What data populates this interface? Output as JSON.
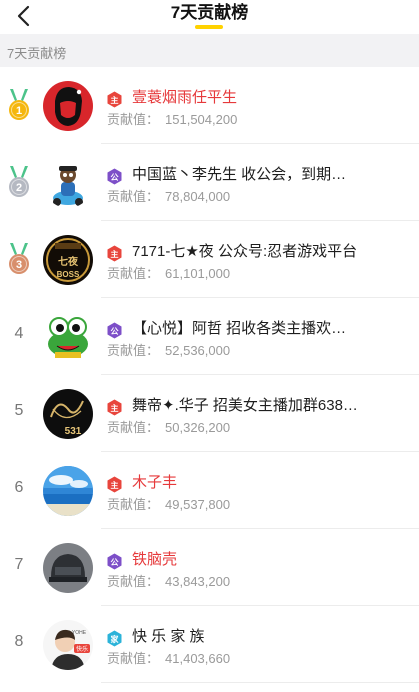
{
  "header": {
    "title": "7天贡献榜",
    "accent_color": "#ffd200"
  },
  "section": {
    "label": "7天贡献榜"
  },
  "contribution_label": "贡献值：",
  "badge_labels": {
    "host": "主",
    "guild": "公",
    "family": "家"
  },
  "colors": {
    "host_badge": "#e8453c",
    "guild_badge": "#7d4fc8",
    "family_badge": "#2bb3d9",
    "name_highlight": "#e6393b",
    "gold_medal": "#f5b70e",
    "silver_medal": "#b5b9c2",
    "bronze_medal": "#d88f6c"
  },
  "entries": [
    {
      "rank": "1",
      "medal": "gold",
      "badge": "host",
      "name": "壹蓑烟雨任平生",
      "name_color": "red",
      "value": "151,504,200",
      "avatar": "portrait-avatar"
    },
    {
      "rank": "2",
      "medal": "silver",
      "badge": "guild",
      "name": "中国蓝丶李先生  收公会，到期…",
      "name_color": "normal",
      "value": "78,804,000",
      "avatar": "rider-avatar"
    },
    {
      "rank": "3",
      "medal": "bronze",
      "badge": "host",
      "name": "7171-七★夜 公众号:忍者游戏平台",
      "name_color": "normal",
      "value": "61,101,000",
      "avatar": "boss-avatar"
    },
    {
      "rank": "4",
      "medal": "",
      "badge": "guild",
      "name": "【心悦】阿哲  招收各类主播欢…",
      "name_color": "normal",
      "value": "52,536,000",
      "avatar": "frog-avatar"
    },
    {
      "rank": "5",
      "medal": "",
      "badge": "host",
      "name": "舞帝✦.华子 招美女主播加群638…",
      "name_color": "normal",
      "value": "50,326,200",
      "avatar": "signature-avatar"
    },
    {
      "rank": "6",
      "medal": "",
      "badge": "host",
      "name": "木子丰",
      "name_color": "red",
      "value": "49,537,800",
      "avatar": "seascape-avatar"
    },
    {
      "rank": "7",
      "medal": "",
      "badge": "guild",
      "name": "铁脑壳",
      "name_color": "red",
      "value": "43,843,200",
      "avatar": "helmet-avatar"
    },
    {
      "rank": "8",
      "medal": "",
      "badge": "family",
      "name": "快 乐 家 族",
      "name_color": "normal",
      "value": "41,403,660",
      "avatar": "cartoon-avatar"
    }
  ],
  "avatar_texts": {
    "boss_top": "七夜",
    "boss_bottom": "BOSS",
    "signature_num": "531",
    "cartoon_tag": "快乐",
    "cartoon_top": "YOHE"
  }
}
